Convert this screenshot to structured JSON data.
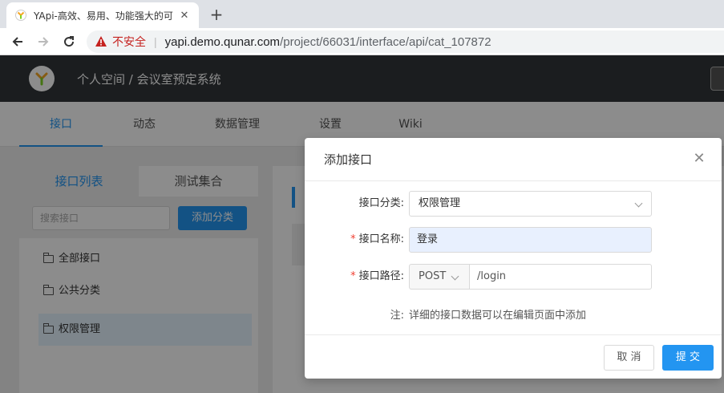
{
  "browser": {
    "tab_title": "YApi-高效、易用、功能强大的可",
    "security_label": "不安全",
    "url_host": "yapi.demo.qunar.com",
    "url_path": "/project/66031/interface/api/cat_107872"
  },
  "app": {
    "breadcrumb": "个人空间 / 会议室预定系统"
  },
  "subnav": {
    "items": [
      "接口",
      "动态",
      "数据管理",
      "设置",
      "Wiki"
    ],
    "active": "接口"
  },
  "left_panel": {
    "tabs": [
      "接口列表",
      "测试集合"
    ],
    "search_placeholder": "搜索接口",
    "add_button": "添加分类",
    "categories": [
      "全部接口",
      "公共分类",
      "权限管理"
    ],
    "selected_category": "权限管理"
  },
  "modal": {
    "title": "添加接口",
    "category_label": "接口分类:",
    "category_value": "权限管理",
    "name_label": "接口名称:",
    "name_value": "登录",
    "path_label": "接口路径:",
    "method_value": "POST",
    "path_value": "/login",
    "note_label": "注:",
    "note_text": "详细的接口数据可以在编辑页面中添加",
    "cancel_label": "取 消",
    "submit_label": "提 交",
    "required_mark": "*"
  },
  "colors": {
    "accent": "#2395f1",
    "header_bg": "#32363a",
    "required": "#f04134",
    "insecure": "#c5221f"
  }
}
